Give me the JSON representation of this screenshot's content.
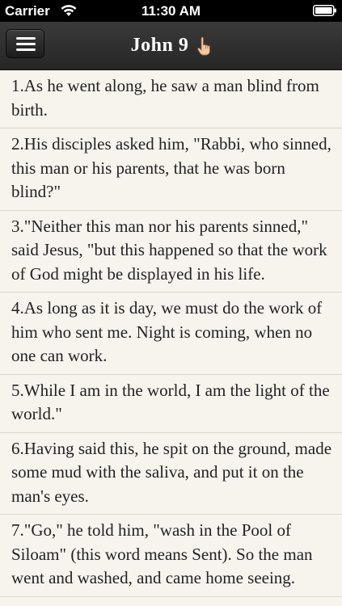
{
  "status_bar": {
    "carrier": "Carrier",
    "time": "11:30 AM"
  },
  "nav_bar": {
    "title": "John 9",
    "menu_icon": "hamburger-menu-icon",
    "title_icon": "pointing-hand-icon"
  },
  "verses": [
    "1.As he went along, he saw a man blind from birth.",
    "2.His disciples asked him, \"Rabbi, who sinned, this man or his parents, that he was born blind?\"",
    "3.\"Neither this man nor his parents sinned,\" said Jesus, \"but this happened so that the work of God might be displayed in his life.",
    "4.As long as it is day, we must do the work of him who sent me. Night is coming, when no one can work.",
    "5.While I am in the world, I am the light of the world.\"",
    "6.Having said this, he spit on the ground, made some mud with the saliva, and put it on the man's eyes.",
    "7.\"Go,\" he told him, \"wash in the Pool of Siloam\" (this word means Sent). So the man went and washed, and came home seeing."
  ],
  "colors": {
    "nav_background": "#2e2e2e",
    "page_background": "#f7f4ee",
    "divider": "#dcd7cd",
    "text": "#222222"
  }
}
